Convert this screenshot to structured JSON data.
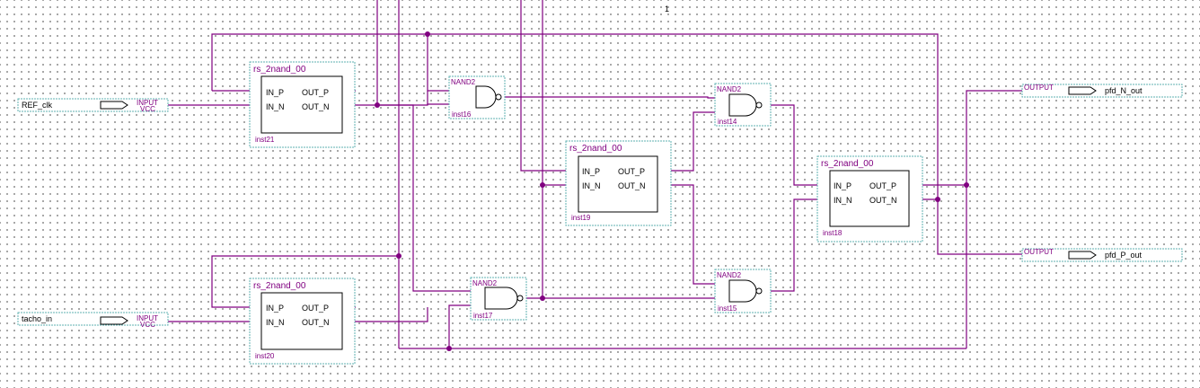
{
  "page_number": "1",
  "symbols": [
    {
      "type": "rs_2nand_00",
      "instance": "inst21",
      "pins_in": [
        "IN_P",
        "IN_N"
      ],
      "pins_out": [
        "OUT_P",
        "OUT_N"
      ]
    },
    {
      "type": "rs_2nand_00",
      "instance": "inst20",
      "pins_in": [
        "IN_P",
        "IN_N"
      ],
      "pins_out": [
        "OUT_P",
        "OUT_N"
      ]
    },
    {
      "type": "rs_2nand_00",
      "instance": "inst19",
      "pins_in": [
        "IN_P",
        "IN_N"
      ],
      "pins_out": [
        "OUT_P",
        "OUT_N"
      ]
    },
    {
      "type": "rs_2nand_00",
      "instance": "inst18",
      "pins_in": [
        "IN_P",
        "IN_N"
      ],
      "pins_out": [
        "OUT_P",
        "OUT_N"
      ]
    }
  ],
  "gates": [
    {
      "type": "NAND2",
      "instance": "inst16"
    },
    {
      "type": "NAND2",
      "instance": "inst17"
    },
    {
      "type": "NAND2",
      "instance": "inst14"
    },
    {
      "type": "NAND2",
      "instance": "inst15"
    }
  ],
  "inputs": [
    {
      "name": "REF_clk",
      "kind": "INPUT",
      "default": "VCC"
    },
    {
      "name": "tacho_in",
      "kind": "INPUT",
      "default": "VCC"
    }
  ],
  "outputs": [
    {
      "name": "pfd_N_out",
      "kind": "OUTPUT"
    },
    {
      "name": "pfd_P_out",
      "kind": "OUTPUT"
    }
  ],
  "colors": {
    "wire": "#800080",
    "frame": "#5fb0b0",
    "grid_dot": "#5a5a5a"
  }
}
